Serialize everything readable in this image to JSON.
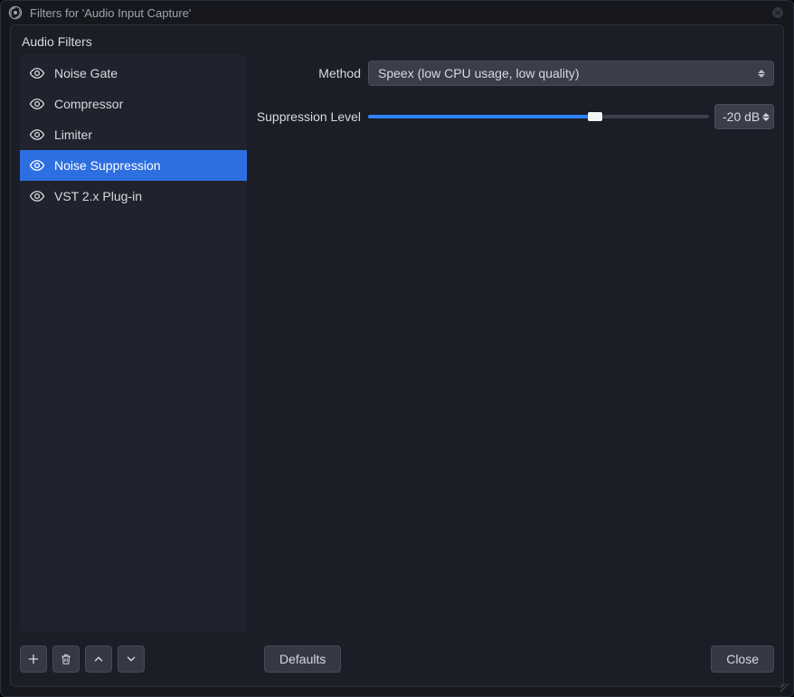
{
  "window": {
    "title": "Filters for 'Audio Input Capture'"
  },
  "section_title": "Audio Filters",
  "filters": [
    {
      "label": "Noise Gate",
      "selected": false
    },
    {
      "label": "Compressor",
      "selected": false
    },
    {
      "label": "Limiter",
      "selected": false
    },
    {
      "label": "Noise Suppression",
      "selected": true
    },
    {
      "label": "VST 2.x Plug-in",
      "selected": false
    }
  ],
  "settings": {
    "method_label": "Method",
    "method_value": "Speex (low CPU usage, low quality)",
    "suppression_label": "Suppression Level",
    "suppression_db": -20,
    "suppression_min_db": -60,
    "suppression_max_db": 0,
    "suppression_value_text": "-20 dB"
  },
  "buttons": {
    "defaults": "Defaults",
    "close": "Close"
  }
}
